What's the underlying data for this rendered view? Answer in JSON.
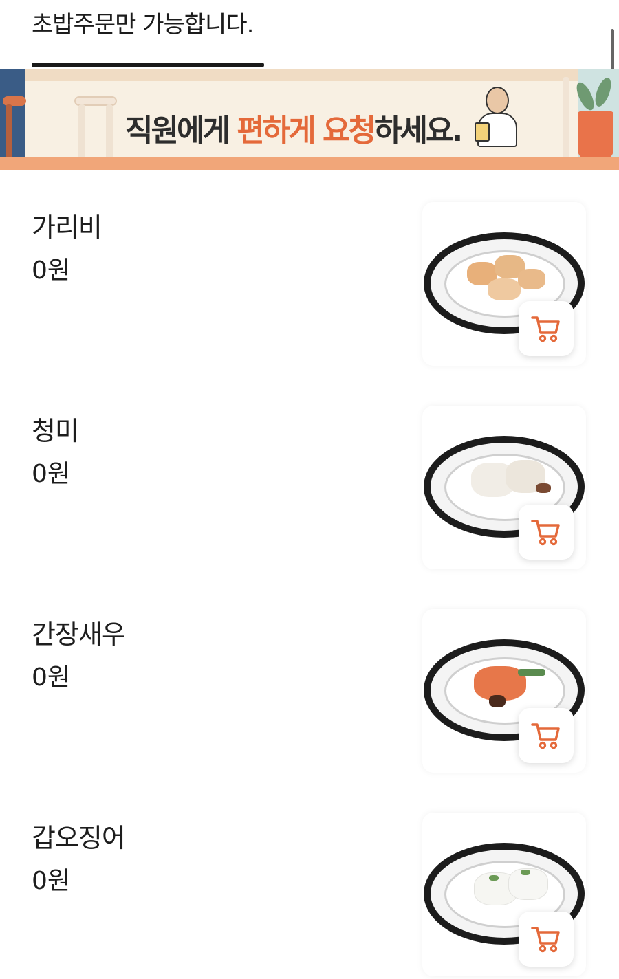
{
  "notice": {
    "text": "초밥주문만 가능합니다."
  },
  "banner": {
    "text_part1": "직원에게 ",
    "text_part2": "편하게",
    "text_part3": " ",
    "text_part4": "요청",
    "text_part5": "하세요."
  },
  "colors": {
    "accent": "#e4693a",
    "banner_bg": "#f8f0e3",
    "floor": "#f1a679"
  },
  "menu": {
    "items": [
      {
        "name": "가리비",
        "price": "0원",
        "icon": "scallop-sushi-plate",
        "cart_icon": "cart-icon"
      },
      {
        "name": "청미",
        "price": "0원",
        "icon": "shrimp-sushi-plate",
        "cart_icon": "cart-icon"
      },
      {
        "name": "간장새우",
        "price": "0원",
        "icon": "soy-shrimp-sushi-plate",
        "cart_icon": "cart-icon"
      },
      {
        "name": "갑오징어",
        "price": "0원",
        "icon": "cuttlefish-sushi-plate",
        "cart_icon": "cart-icon"
      }
    ]
  }
}
